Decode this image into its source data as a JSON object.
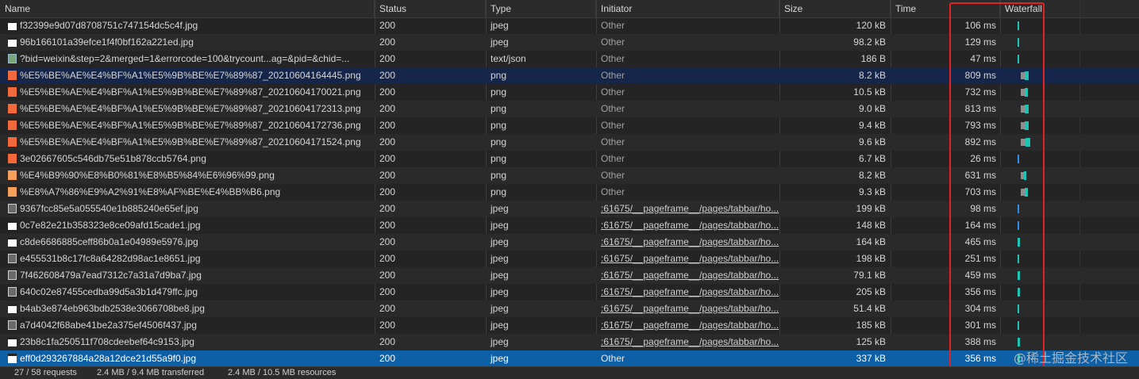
{
  "columns": {
    "name": "Name",
    "status": "Status",
    "type": "Type",
    "initiator": "Initiator",
    "size": "Size",
    "time": "Time",
    "waterfall": "Waterfall"
  },
  "rows": [
    {
      "name": "f32399e9d07d8708751c747154dc5c4f.jpg",
      "status": "200",
      "type": "jpeg",
      "initiator": "Other",
      "size": "120 kB",
      "time": "106 ms",
      "icon": "image-file-icon",
      "wait_ms": 0,
      "download_ms": 106
    },
    {
      "name": "96b166101a39efce1f4f0bf162a221ed.jpg",
      "status": "200",
      "type": "jpeg",
      "initiator": "Other",
      "size": "98.2 kB",
      "time": "129 ms",
      "icon": "image-file-icon",
      "wait_ms": 0,
      "download_ms": 129
    },
    {
      "name": "?bid=weixin&step=2&merged=1&errorcode=100&trycount...ag=&pid=&chid=...",
      "status": "200",
      "type": "text/json",
      "initiator": "Other",
      "size": "186 B",
      "time": "47 ms",
      "icon": "json-file-icon",
      "wait_ms": 0,
      "download_ms": 47
    },
    {
      "name": "%E5%BE%AE%E4%BF%A1%E5%9B%BE%E7%89%87_20210604164445.png",
      "status": "200",
      "type": "png",
      "initiator": "Other",
      "size": "8.2 kB",
      "time": "809 ms",
      "icon": "png-file-icon",
      "wait_ms": 560,
      "download_ms": 249,
      "highlight": true
    },
    {
      "name": "%E5%BE%AE%E4%BF%A1%E5%9B%BE%E7%89%87_20210604170021.png",
      "status": "200",
      "type": "png",
      "initiator": "Other",
      "size": "10.5 kB",
      "time": "732 ms",
      "icon": "png-file-icon",
      "wait_ms": 530,
      "download_ms": 202
    },
    {
      "name": "%E5%BE%AE%E4%BF%A1%E5%9B%BE%E7%89%87_20210604172313.png",
      "status": "200",
      "type": "png",
      "initiator": "Other",
      "size": "9.0 kB",
      "time": "813 ms",
      "icon": "png-file-icon",
      "wait_ms": 580,
      "download_ms": 233
    },
    {
      "name": "%E5%BE%AE%E4%BF%A1%E5%9B%BE%E7%89%87_20210604172736.png",
      "status": "200",
      "type": "png",
      "initiator": "Other",
      "size": "9.4 kB",
      "time": "793 ms",
      "icon": "png-file-icon",
      "wait_ms": 570,
      "download_ms": 223
    },
    {
      "name": "%E5%BE%AE%E4%BF%A1%E5%9B%BE%E7%89%87_20210604171524.png",
      "status": "200",
      "type": "png",
      "initiator": "Other",
      "size": "9.6 kB",
      "time": "892 ms",
      "icon": "png-file-icon",
      "wait_ms": 600,
      "download_ms": 292
    },
    {
      "name": "3e02667605c546db75e51b878ccb5764.png",
      "status": "200",
      "type": "png",
      "initiator": "Other",
      "size": "6.7 kB",
      "time": "26 ms",
      "icon": "png-file-icon",
      "wait_ms": 0,
      "download_ms": 26,
      "blue": true
    },
    {
      "name": "%E4%B9%90%E8%B0%81%E8%B5%84%E6%96%99.png",
      "status": "200",
      "type": "png",
      "initiator": "Other",
      "size": "8.2 kB",
      "time": "631 ms",
      "icon": "png-file-icon",
      "wait_ms": 470,
      "download_ms": 161
    },
    {
      "name": "%E8%A7%86%E9%A2%91%E8%AF%BE%E4%BB%B6.png",
      "status": "200",
      "type": "png",
      "initiator": "Other",
      "size": "9.3 kB",
      "time": "703 ms",
      "icon": "png-file-icon",
      "wait_ms": 520,
      "download_ms": 183
    },
    {
      "name": "9367fcc85e5a055540e1b885240e65ef.jpg",
      "status": "200",
      "type": "jpeg",
      "initiator": ":61675/__pageframe__/pages/tabbar/ho...",
      "size": "199 kB",
      "time": "98 ms",
      "icon": "photo-file-icon",
      "wait_ms": 0,
      "download_ms": 98,
      "link": true,
      "blue": true
    },
    {
      "name": "0c7e82e21b358323e8ce09afd15cade1.jpg",
      "status": "200",
      "type": "jpeg",
      "initiator": ":61675/__pageframe__/pages/tabbar/ho...",
      "size": "148 kB",
      "time": "164 ms",
      "icon": "image-file-icon",
      "wait_ms": 0,
      "download_ms": 164,
      "link": true,
      "blue": true
    },
    {
      "name": "c8de6686885ceff86b0a1e04989e5976.jpg",
      "status": "200",
      "type": "jpeg",
      "initiator": ":61675/__pageframe__/pages/tabbar/ho...",
      "size": "164 kB",
      "time": "465 ms",
      "icon": "image-file-icon",
      "wait_ms": 0,
      "download_ms": 465,
      "link": true
    },
    {
      "name": "e455531b8c17fc8a64282d98ac1e8651.jpg",
      "status": "200",
      "type": "jpeg",
      "initiator": ":61675/__pageframe__/pages/tabbar/ho...",
      "size": "198 kB",
      "time": "251 ms",
      "icon": "photo-file-icon",
      "wait_ms": 0,
      "download_ms": 251,
      "link": true
    },
    {
      "name": "7f462608479a7ead7312c7a31a7d9ba7.jpg",
      "status": "200",
      "type": "jpeg",
      "initiator": ":61675/__pageframe__/pages/tabbar/ho...",
      "size": "79.1 kB",
      "time": "459 ms",
      "icon": "photo-file-icon",
      "wait_ms": 0,
      "download_ms": 459,
      "link": true
    },
    {
      "name": "640c02e87455cedba99d5a3b1d479ffc.jpg",
      "status": "200",
      "type": "jpeg",
      "initiator": ":61675/__pageframe__/pages/tabbar/ho...",
      "size": "205 kB",
      "time": "356 ms",
      "icon": "photo-file-icon",
      "wait_ms": 0,
      "download_ms": 356,
      "link": true
    },
    {
      "name": "b4ab3e874eb963bdb2538e3066708be8.jpg",
      "status": "200",
      "type": "jpeg",
      "initiator": ":61675/__pageframe__/pages/tabbar/ho...",
      "size": "51.4 kB",
      "time": "304 ms",
      "icon": "image-file-icon",
      "wait_ms": 0,
      "download_ms": 304,
      "link": true
    },
    {
      "name": "a7d4042f68abe41be2a375ef4506f437.jpg",
      "status": "200",
      "type": "jpeg",
      "initiator": ":61675/__pageframe__/pages/tabbar/ho...",
      "size": "185 kB",
      "time": "301 ms",
      "icon": "photo-file-icon",
      "wait_ms": 0,
      "download_ms": 301,
      "link": true
    },
    {
      "name": "23b8c1fa250511f708cdeebef64c9153.jpg",
      "status": "200",
      "type": "jpeg",
      "initiator": ":61675/__pageframe__/pages/tabbar/ho...",
      "size": "125 kB",
      "time": "388 ms",
      "icon": "image-file-icon",
      "wait_ms": 0,
      "download_ms": 388,
      "link": true
    },
    {
      "name": "eff0d293267884a28a12dce21d55a9f0.jpg",
      "status": "200",
      "type": "jpeg",
      "initiator": "Other",
      "size": "337 kB",
      "time": "356 ms",
      "icon": "image-file-icon",
      "wait_ms": 0,
      "download_ms": 356,
      "selected": true
    }
  ],
  "statusbar": {
    "requests": "27 / 58 requests",
    "transferred": "2.4 MB / 9.4 MB transferred",
    "resources": "2.4 MB / 10.5 MB resources"
  },
  "watermark": "@稀土掘金技术社区",
  "colors": {
    "selected_row": "#0d5fa6",
    "highlight_box": "#e02424",
    "download_bar": "#1ec4b3",
    "waiting_bar": "#8e8e8e"
  }
}
